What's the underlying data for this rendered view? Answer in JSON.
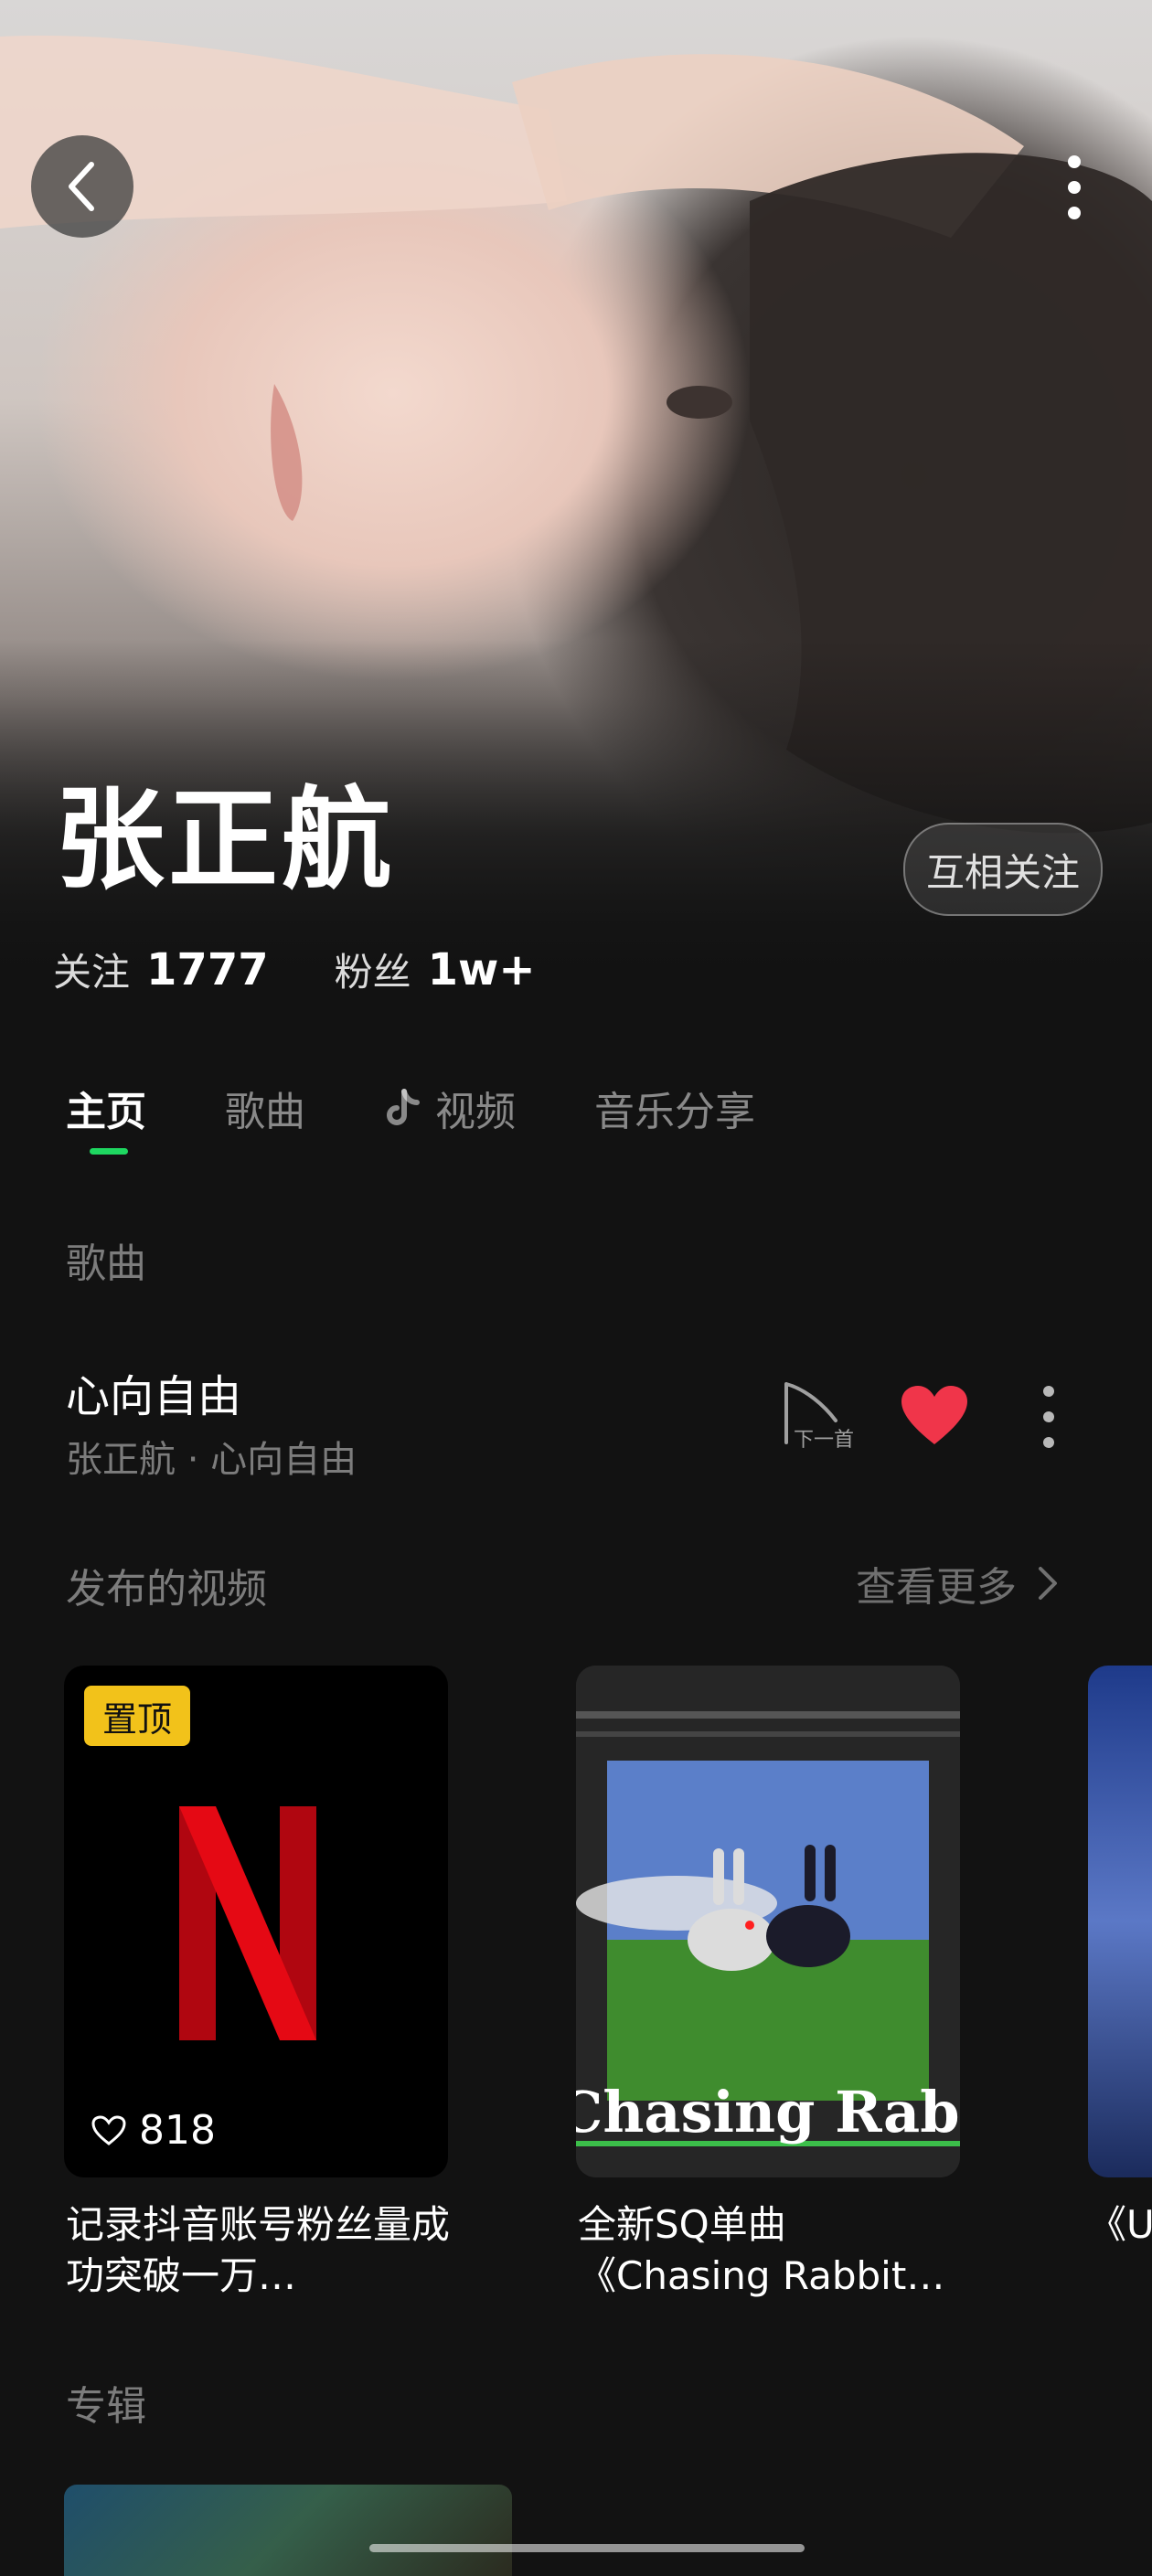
{
  "artist": {
    "name": "张正航",
    "follow_button": "互相关注",
    "following_label": "关注",
    "following_count": "1777",
    "fans_label": "粉丝",
    "fans_count": "1w+"
  },
  "tabs": [
    {
      "label": "主页",
      "active": true
    },
    {
      "label": "歌曲",
      "active": false
    },
    {
      "label": "视频",
      "active": false,
      "icon": "tiktok-icon"
    },
    {
      "label": "音乐分享",
      "active": false
    }
  ],
  "songs_section": {
    "title": "歌曲",
    "song": {
      "title": "心向自由",
      "subtitle": "张正航 · 心向自由",
      "next_icon_label": "下一首"
    }
  },
  "videos_section": {
    "title": "发布的视频",
    "see_more": "查看更多",
    "videos": [
      {
        "badge": "置顶",
        "likes": "818",
        "caption": "记录抖音账号粉丝量成功突破一万…"
      },
      {
        "overlay_text": "Chasing Rabbit",
        "caption": "全新SQ单曲《Chasing Rabbit…"
      },
      {
        "caption": "《Ur"
      }
    ]
  },
  "albums_section": {
    "title": "专辑"
  },
  "colors": {
    "accent": "#1ed760",
    "heart": "#f0354a",
    "pin_badge": "#f2c21a",
    "background": "#121212"
  }
}
